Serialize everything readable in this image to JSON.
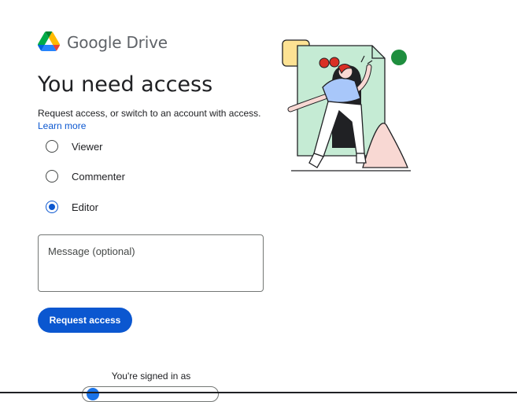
{
  "brand": {
    "name": "Google Drive"
  },
  "title": "You need access",
  "subtitle": "Request access, or switch to an account with access.",
  "learn_more": "Learn more",
  "roles": [
    {
      "label": "Viewer",
      "selected": false
    },
    {
      "label": "Commenter",
      "selected": false
    },
    {
      "label": "Editor",
      "selected": true
    }
  ],
  "message": {
    "placeholder": "Message (optional)",
    "value": ""
  },
  "request_button": "Request access",
  "signed_in_label": "You're signed in as",
  "colors": {
    "accent": "#0b57d0",
    "text": "#202124",
    "illustration_bg": "#c5ebd4",
    "dot": "#1e8e3e"
  }
}
